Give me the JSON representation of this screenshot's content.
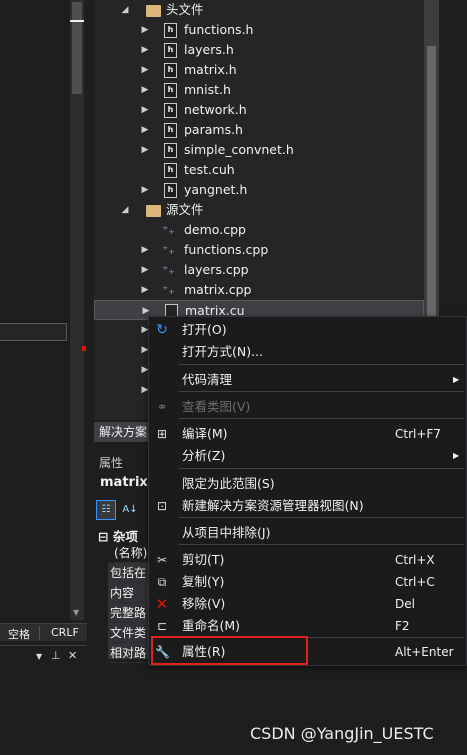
{
  "tree": {
    "header_folder": "头文件",
    "header_files": [
      "functions.h",
      "layers.h",
      "matrix.h",
      "mnist.h",
      "network.h",
      "params.h",
      "simple_convnet.h",
      "test.cuh",
      "yangnet.h"
    ],
    "source_folder": "源文件",
    "source_files": [
      "demo.cpp",
      "functions.cpp",
      "layers.cpp",
      "matrix.cpp"
    ],
    "selected_file": "matrix.cu"
  },
  "solution_explorer_tab": "解决方案",
  "properties": {
    "title": "属性",
    "object": "matrix.c",
    "category": "杂项",
    "rows": [
      "(名称)",
      "包括在",
      "内容",
      "完整路",
      "文件类",
      "相对路"
    ]
  },
  "statusbar": {
    "spaces": "空格",
    "line_ending": "CRLF"
  },
  "context_menu": {
    "items": [
      {
        "label": "打开(O)",
        "shortcut": "",
        "icon": "open-icon",
        "submenu": false,
        "enabled": true
      },
      {
        "label": "打开方式(N)...",
        "shortcut": "",
        "icon": "",
        "submenu": false,
        "enabled": true
      },
      {
        "label": "代码清理",
        "shortcut": "",
        "icon": "",
        "submenu": true,
        "enabled": true
      },
      {
        "label": "查看类图(V)",
        "shortcut": "",
        "icon": "class-diagram-icon",
        "submenu": false,
        "enabled": false
      },
      {
        "label": "编译(M)",
        "shortcut": "Ctrl+F7",
        "icon": "compile-icon",
        "submenu": false,
        "enabled": true
      },
      {
        "label": "分析(Z)",
        "shortcut": "",
        "icon": "",
        "submenu": true,
        "enabled": true
      },
      {
        "label": "限定为此范围(S)",
        "shortcut": "",
        "icon": "",
        "submenu": false,
        "enabled": true
      },
      {
        "label": "新建解决方案资源管理器视图(N)",
        "shortcut": "",
        "icon": "new-view-icon",
        "submenu": false,
        "enabled": true
      },
      {
        "label": "从项目中排除(J)",
        "shortcut": "",
        "icon": "",
        "submenu": false,
        "enabled": true
      },
      {
        "label": "剪切(T)",
        "shortcut": "Ctrl+X",
        "icon": "cut-icon",
        "submenu": false,
        "enabled": true
      },
      {
        "label": "复制(Y)",
        "shortcut": "Ctrl+C",
        "icon": "copy-icon",
        "submenu": false,
        "enabled": true
      },
      {
        "label": "移除(V)",
        "shortcut": "Del",
        "icon": "remove-icon",
        "submenu": false,
        "enabled": true
      },
      {
        "label": "重命名(M)",
        "shortcut": "F2",
        "icon": "rename-icon",
        "submenu": false,
        "enabled": true
      },
      {
        "label": "属性(R)",
        "shortcut": "Alt+Enter",
        "icon": "wrench-icon",
        "submenu": false,
        "enabled": true
      }
    ]
  },
  "watermark": "CSDN @YangJin_UESTC",
  "colors": {
    "background": "#1e1e1e",
    "menu_bg": "#1b1b1c",
    "highlight_border": "#e0201b",
    "accent_blue": "#3794ff"
  }
}
